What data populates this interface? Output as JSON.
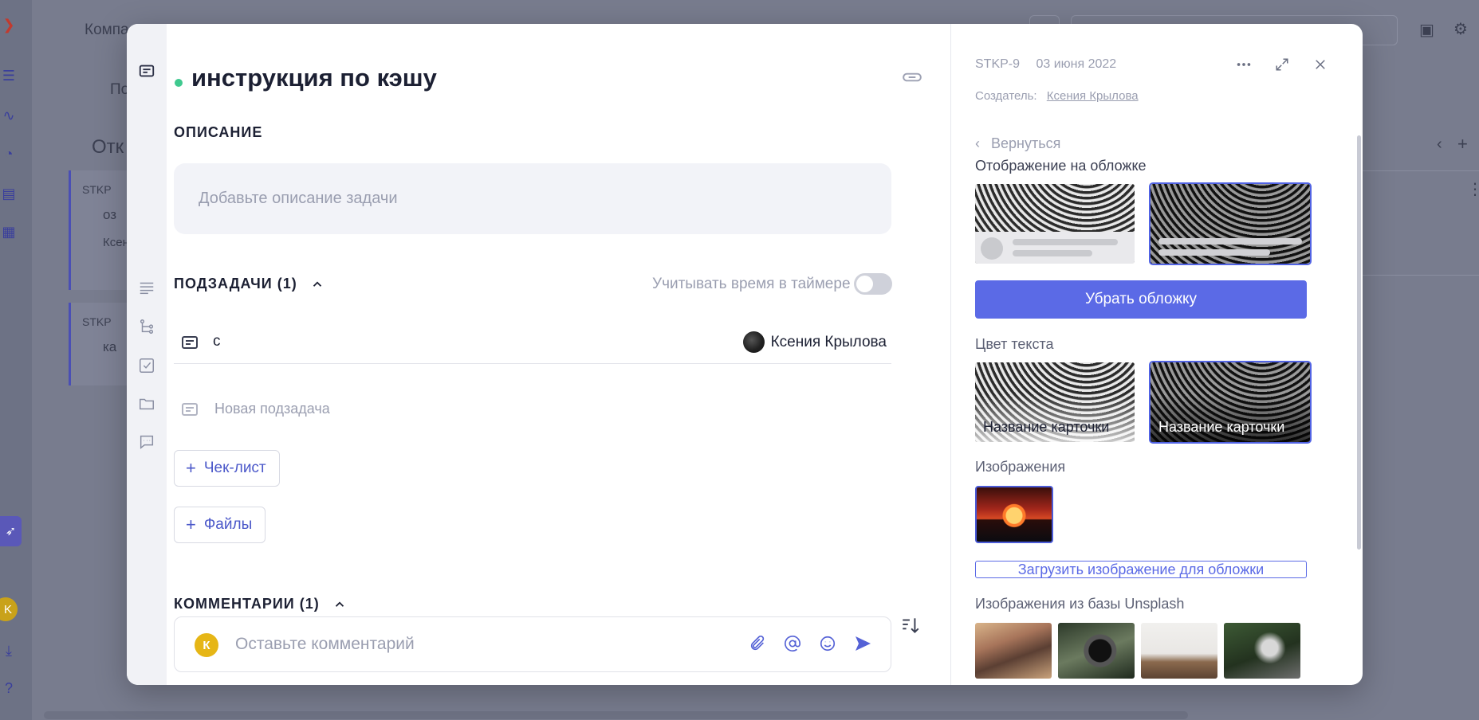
{
  "background": {
    "breadcrumb": "Компа",
    "tab_partial": "По",
    "column_title": "Отк",
    "card1_id": "STKP",
    "card1_text": "оз",
    "card1_user": "Ксен",
    "card2_id": "STKP",
    "card2_text": "ка"
  },
  "modal": {
    "title": "инструкция по кэшу",
    "description": {
      "heading": "ОПИСАНИЕ",
      "placeholder": "Добавьте описание задачи"
    },
    "subtasks": {
      "heading": "ПОДЗАДАЧИ (1)",
      "timer_label": "Учитывать время в таймере",
      "items": [
        {
          "name": "с",
          "assignee": "Ксения Крылова"
        }
      ],
      "new_placeholder": "Новая подзадача"
    },
    "checklist_button": "Чек-лист",
    "files_button": "Файлы",
    "comments": {
      "heading": "КОММЕНТАРИИ (1)",
      "avatar_letter": "К",
      "placeholder": "Оставьте комментарий"
    }
  },
  "sidebar": {
    "task_id": "STKP-9",
    "date": "03 июня 2022",
    "creator_label": "Создатель:",
    "creator_name": "Ксения Крылова",
    "back_label": "Вернуться",
    "cover_display_label": "Отображение на обложке",
    "remove_cover_button": "Убрать обложку",
    "text_color_label": "Цвет текста",
    "card_title_sample_light": "Название карточки",
    "card_title_sample_dark": "Название карточки",
    "images_label": "Изображения",
    "upload_button": "Загрузить изображение для обложки",
    "unsplash_label": "Изображения из базы Unsplash"
  },
  "icons": {
    "rail": [
      "card-icon",
      "text-lines-icon",
      "subtask-icon",
      "checklist-icon",
      "folder-icon",
      "comment-icon"
    ],
    "tools": [
      "more-icon",
      "expand-icon",
      "close-icon",
      "link-icon",
      "sort-icon",
      "attach-icon",
      "mention-icon",
      "emoji-icon",
      "send-icon"
    ]
  },
  "colors": {
    "accent": "#5b6ae6",
    "status_dot": "#3fc98f",
    "comment_avatar": "#e6b616"
  }
}
